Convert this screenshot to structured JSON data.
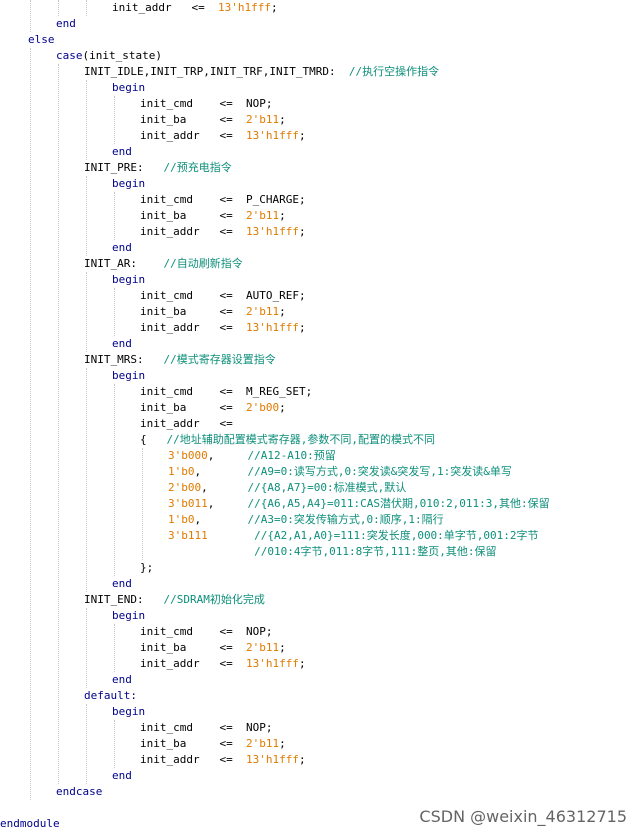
{
  "code": {
    "lines": [
      {
        "indent": 3,
        "tokens": [
          {
            "t": "id",
            "v": "init_addr"
          },
          {
            "t": "op",
            "v": "   <=  "
          },
          {
            "t": "num",
            "v": "13'h1fff"
          },
          {
            "t": "op",
            "v": ";"
          }
        ]
      },
      {
        "indent": 1,
        "tokens": [
          {
            "t": "kw",
            "v": "end"
          }
        ]
      },
      {
        "indent": 0,
        "tokens": [
          {
            "t": "kw",
            "v": "else"
          }
        ]
      },
      {
        "indent": 1,
        "tokens": [
          {
            "t": "kw",
            "v": "case"
          },
          {
            "t": "id",
            "v": "(init_state)"
          }
        ]
      },
      {
        "indent": 2,
        "tokens": [
          {
            "t": "id",
            "v": "INIT_IDLE,INIT_TRP,INIT_TRF,INIT_TMRD:  "
          },
          {
            "t": "cmt",
            "v": "//执行空操作指令"
          }
        ]
      },
      {
        "indent": 3,
        "tokens": [
          {
            "t": "kw",
            "v": "begin"
          }
        ]
      },
      {
        "indent": 4,
        "tokens": [
          {
            "t": "id",
            "v": "init_cmd"
          },
          {
            "t": "op",
            "v": "    <=  "
          },
          {
            "t": "id",
            "v": "NOP;"
          }
        ]
      },
      {
        "indent": 4,
        "tokens": [
          {
            "t": "id",
            "v": "init_ba"
          },
          {
            "t": "op",
            "v": "     <=  "
          },
          {
            "t": "num",
            "v": "2'b11"
          },
          {
            "t": "op",
            "v": ";"
          }
        ]
      },
      {
        "indent": 4,
        "tokens": [
          {
            "t": "id",
            "v": "init_addr"
          },
          {
            "t": "op",
            "v": "   <=  "
          },
          {
            "t": "num",
            "v": "13'h1fff"
          },
          {
            "t": "op",
            "v": ";"
          }
        ]
      },
      {
        "indent": 3,
        "tokens": [
          {
            "t": "kw",
            "v": "end"
          }
        ]
      },
      {
        "indent": 2,
        "tokens": [
          {
            "t": "id",
            "v": "INIT_PRE:   "
          },
          {
            "t": "cmt",
            "v": "//预充电指令"
          }
        ]
      },
      {
        "indent": 3,
        "tokens": [
          {
            "t": "kw",
            "v": "begin"
          }
        ]
      },
      {
        "indent": 4,
        "tokens": [
          {
            "t": "id",
            "v": "init_cmd"
          },
          {
            "t": "op",
            "v": "    <=  "
          },
          {
            "t": "id",
            "v": "P_CHARGE;"
          }
        ]
      },
      {
        "indent": 4,
        "tokens": [
          {
            "t": "id",
            "v": "init_ba"
          },
          {
            "t": "op",
            "v": "     <=  "
          },
          {
            "t": "num",
            "v": "2'b11"
          },
          {
            "t": "op",
            "v": ";"
          }
        ]
      },
      {
        "indent": 4,
        "tokens": [
          {
            "t": "id",
            "v": "init_addr"
          },
          {
            "t": "op",
            "v": "   <=  "
          },
          {
            "t": "num",
            "v": "13'h1fff"
          },
          {
            "t": "op",
            "v": ";"
          }
        ]
      },
      {
        "indent": 3,
        "tokens": [
          {
            "t": "kw",
            "v": "end"
          }
        ]
      },
      {
        "indent": 2,
        "tokens": [
          {
            "t": "id",
            "v": "INIT_AR:    "
          },
          {
            "t": "cmt",
            "v": "//自动刷新指令"
          }
        ]
      },
      {
        "indent": 3,
        "tokens": [
          {
            "t": "kw",
            "v": "begin"
          }
        ]
      },
      {
        "indent": 4,
        "tokens": [
          {
            "t": "id",
            "v": "init_cmd"
          },
          {
            "t": "op",
            "v": "    <=  "
          },
          {
            "t": "id",
            "v": "AUTO_REF;"
          }
        ]
      },
      {
        "indent": 4,
        "tokens": [
          {
            "t": "id",
            "v": "init_ba"
          },
          {
            "t": "op",
            "v": "     <=  "
          },
          {
            "t": "num",
            "v": "2'b11"
          },
          {
            "t": "op",
            "v": ";"
          }
        ]
      },
      {
        "indent": 4,
        "tokens": [
          {
            "t": "id",
            "v": "init_addr"
          },
          {
            "t": "op",
            "v": "   <=  "
          },
          {
            "t": "num",
            "v": "13'h1fff"
          },
          {
            "t": "op",
            "v": ";"
          }
        ]
      },
      {
        "indent": 3,
        "tokens": [
          {
            "t": "kw",
            "v": "end"
          }
        ]
      },
      {
        "indent": 2,
        "tokens": [
          {
            "t": "id",
            "v": "INIT_MRS:   "
          },
          {
            "t": "cmt",
            "v": "//模式寄存器设置指令"
          }
        ]
      },
      {
        "indent": 3,
        "tokens": [
          {
            "t": "kw",
            "v": "begin"
          }
        ]
      },
      {
        "indent": 4,
        "tokens": [
          {
            "t": "id",
            "v": "init_cmd"
          },
          {
            "t": "op",
            "v": "    <=  "
          },
          {
            "t": "id",
            "v": "M_REG_SET;"
          }
        ]
      },
      {
        "indent": 4,
        "tokens": [
          {
            "t": "id",
            "v": "init_ba"
          },
          {
            "t": "op",
            "v": "     <=  "
          },
          {
            "t": "num",
            "v": "2'b00"
          },
          {
            "t": "op",
            "v": ";"
          }
        ]
      },
      {
        "indent": 4,
        "tokens": [
          {
            "t": "id",
            "v": "init_addr"
          },
          {
            "t": "op",
            "v": "   <="
          }
        ]
      },
      {
        "indent": 4,
        "tokens": [
          {
            "t": "op",
            "v": "{   "
          },
          {
            "t": "cmt",
            "v": "//地址辅助配置模式寄存器,参数不同,配置的模式不同"
          }
        ]
      },
      {
        "indent": 5,
        "tokens": [
          {
            "t": "num",
            "v": "3'b000"
          },
          {
            "t": "op",
            "v": ",     "
          },
          {
            "t": "cmt",
            "v": "//A12-A10:预留"
          }
        ]
      },
      {
        "indent": 5,
        "tokens": [
          {
            "t": "num",
            "v": "1'b0"
          },
          {
            "t": "op",
            "v": ",       "
          },
          {
            "t": "cmt",
            "v": "//A9=0:读写方式,0:突发读&突发写,1:突发读&单写"
          }
        ]
      },
      {
        "indent": 5,
        "tokens": [
          {
            "t": "num",
            "v": "2'b00"
          },
          {
            "t": "op",
            "v": ",      "
          },
          {
            "t": "cmt",
            "v": "//{A8,A7}=00:标准模式,默认"
          }
        ]
      },
      {
        "indent": 5,
        "tokens": [
          {
            "t": "num",
            "v": "3'b011"
          },
          {
            "t": "op",
            "v": ",     "
          },
          {
            "t": "cmt",
            "v": "//{A6,A5,A4}=011:CAS潜伏期,010:2,011:3,其他:保留"
          }
        ]
      },
      {
        "indent": 5,
        "tokens": [
          {
            "t": "num",
            "v": "1'b0"
          },
          {
            "t": "op",
            "v": ",       "
          },
          {
            "t": "cmt",
            "v": "//A3=0:突发传输方式,0:顺序,1:隔行"
          }
        ]
      },
      {
        "indent": 5,
        "tokens": [
          {
            "t": "num",
            "v": "3'b111"
          },
          {
            "t": "op",
            "v": "       "
          },
          {
            "t": "cmt",
            "v": "//{A2,A1,A0}=111:突发长度,000:单字节,001:2字节"
          }
        ]
      },
      {
        "indent": 5,
        "tokens": [
          {
            "t": "op",
            "v": "             "
          },
          {
            "t": "cmt",
            "v": "//010:4字节,011:8字节,111:整页,其他:保留"
          }
        ]
      },
      {
        "indent": 4,
        "tokens": [
          {
            "t": "op",
            "v": "};"
          }
        ]
      },
      {
        "indent": 3,
        "tokens": [
          {
            "t": "kw",
            "v": "end"
          }
        ]
      },
      {
        "indent": 2,
        "tokens": [
          {
            "t": "id",
            "v": "INIT_END:   "
          },
          {
            "t": "cmt",
            "v": "//SDRAM初始化完成"
          }
        ]
      },
      {
        "indent": 3,
        "tokens": [
          {
            "t": "kw",
            "v": "begin"
          }
        ]
      },
      {
        "indent": 4,
        "tokens": [
          {
            "t": "id",
            "v": "init_cmd"
          },
          {
            "t": "op",
            "v": "    <=  "
          },
          {
            "t": "id",
            "v": "NOP;"
          }
        ]
      },
      {
        "indent": 4,
        "tokens": [
          {
            "t": "id",
            "v": "init_ba"
          },
          {
            "t": "op",
            "v": "     <=  "
          },
          {
            "t": "num",
            "v": "2'b11"
          },
          {
            "t": "op",
            "v": ";"
          }
        ]
      },
      {
        "indent": 4,
        "tokens": [
          {
            "t": "id",
            "v": "init_addr"
          },
          {
            "t": "op",
            "v": "   <=  "
          },
          {
            "t": "num",
            "v": "13'h1fff"
          },
          {
            "t": "op",
            "v": ";"
          }
        ]
      },
      {
        "indent": 3,
        "tokens": [
          {
            "t": "kw",
            "v": "end"
          }
        ]
      },
      {
        "indent": 2,
        "tokens": [
          {
            "t": "kw",
            "v": "default:"
          }
        ]
      },
      {
        "indent": 3,
        "tokens": [
          {
            "t": "kw",
            "v": "begin"
          }
        ]
      },
      {
        "indent": 4,
        "tokens": [
          {
            "t": "id",
            "v": "init_cmd"
          },
          {
            "t": "op",
            "v": "    <=  "
          },
          {
            "t": "id",
            "v": "NOP;"
          }
        ]
      },
      {
        "indent": 4,
        "tokens": [
          {
            "t": "id",
            "v": "init_ba"
          },
          {
            "t": "op",
            "v": "     <=  "
          },
          {
            "t": "num",
            "v": "2'b11"
          },
          {
            "t": "op",
            "v": ";"
          }
        ]
      },
      {
        "indent": 4,
        "tokens": [
          {
            "t": "id",
            "v": "init_addr"
          },
          {
            "t": "op",
            "v": "   <=  "
          },
          {
            "t": "num",
            "v": "13'h1fff"
          },
          {
            "t": "op",
            "v": ";"
          }
        ]
      },
      {
        "indent": 3,
        "tokens": [
          {
            "t": "kw",
            "v": "end"
          }
        ]
      },
      {
        "indent": 1,
        "tokens": [
          {
            "t": "kw",
            "v": "endcase"
          }
        ]
      },
      {
        "indent": 0,
        "tokens": []
      },
      {
        "indent": -1,
        "tokens": [
          {
            "t": "kw",
            "v": "endmodule"
          }
        ]
      }
    ]
  },
  "watermark": {
    "text": "CSDN @weixin_46312715"
  },
  "colors": {
    "keyword": "#00008b",
    "number": "#e17a00",
    "comment": "#0f8f7b",
    "text": "#000000",
    "background": "#ffffff"
  }
}
